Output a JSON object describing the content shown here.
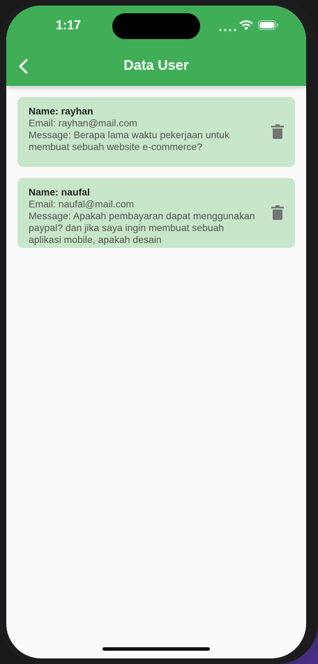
{
  "status_bar": {
    "time": "1:17"
  },
  "appbar": {
    "title": "Data User",
    "color": "#3fae57",
    "back_icon": "chevron-left-icon"
  },
  "users": [
    {
      "name": "Name: rayhan",
      "email": "Email: rayhan@mail.com",
      "message": "Message: Berapa lama waktu pekerjaan untuk membuat sebuah website e-commerce?",
      "delete_icon": "trash-icon"
    },
    {
      "name": "Name: naufal",
      "email": "Email: naufal@mail.com",
      "message": "Message: Apakah pembayaran dapat menggunakan paypal? dan jika saya ingin membuat sebuah aplikasi mobile, apakah desain",
      "delete_icon": "trash-icon"
    }
  ],
  "colors": {
    "card_bg": "#c8e6c9",
    "background": "#fafafa"
  }
}
